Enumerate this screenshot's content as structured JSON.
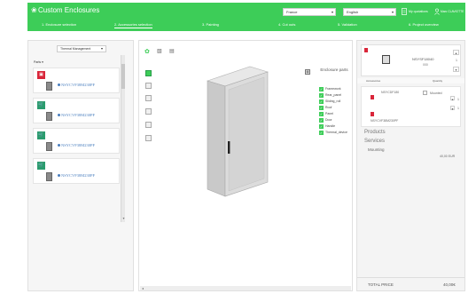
{
  "header": {
    "title": "Custom Enclosures",
    "country": "France",
    "language": "English",
    "my_quotations": "My quotations",
    "user": "Marc CLAVIOTTE"
  },
  "steps": [
    {
      "label": "1. Enclosure selection"
    },
    {
      "label": "2. Accessories selection"
    },
    {
      "label": "3. Painting"
    },
    {
      "label": "4. Cut outs"
    },
    {
      "label": "5. Validation"
    },
    {
      "label": "6. Project overview"
    }
  ],
  "left": {
    "category": "Thermal Management",
    "parts_label": "Parts ▾",
    "cards": [
      {
        "ref": "NSYCVF38M230PF",
        "badge": "delete"
      },
      {
        "ref": "NSYCVF38M230PF",
        "badge": "cart"
      },
      {
        "ref": "NSYCVF38M230PF",
        "badge": "cart"
      },
      {
        "ref": "NSYCVF38M230PF",
        "badge": "cart"
      }
    ]
  },
  "center": {
    "parts_title": "Enclosure parts",
    "parts": [
      "Framework",
      "Rear_panel",
      "Sliding_roll",
      "Roof",
      "Panel",
      "Door",
      "Handle",
      "Thermal_device"
    ]
  },
  "right": {
    "enclosure_ref": "NSYSF18040",
    "enclosure_sub": "000",
    "enclosure_qty": "1",
    "accessories_header": "Accessories",
    "quantity_header": "Quantity",
    "accessory_ref": "NSYCDF180",
    "mounted_label": "Mounted",
    "accessory_qty": "1",
    "accessory_qty2": "1",
    "accessory_ref2": "NSYCVF38M230PF",
    "products_label": "Products",
    "services_label": "Services",
    "mounting_label": "Mounting",
    "mounting_price": "40,00 EUR",
    "total_label": "TOTAL PRICE",
    "total_value": "40,00€"
  }
}
